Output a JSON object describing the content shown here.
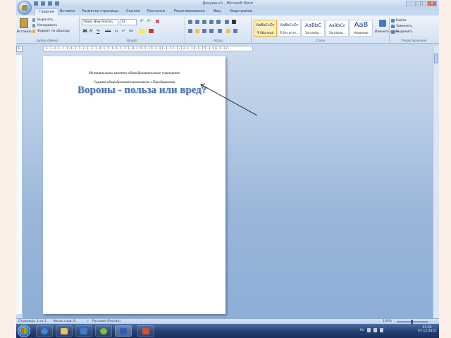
{
  "window": {
    "title": "Документ1 - Microsoft Word"
  },
  "window_controls": {
    "minimize": "–",
    "maximize": "□",
    "close": "x"
  },
  "tabs": [
    {
      "label": "Главная",
      "active": true
    },
    {
      "label": "Вставка"
    },
    {
      "label": "Разметка страницы"
    },
    {
      "label": "Ссылки"
    },
    {
      "label": "Рассылки"
    },
    {
      "label": "Рецензирование"
    },
    {
      "label": "Вид"
    },
    {
      "label": "Надстройки"
    }
  ],
  "clipboard": {
    "paste_label": "Вставить",
    "cut_label": "Вырезать",
    "copy_label": "Копировать",
    "format_painter_label": "Формат по образцу",
    "group_label": "Буфер обмена"
  },
  "font": {
    "name": "Times New Roman",
    "size": "11",
    "grow": "A˄",
    "shrink": "A˅",
    "bold": "Ж",
    "italic": "К",
    "underline": "Ч",
    "strike": "abe",
    "subscript": "x₂",
    "superscript": "x²",
    "case": "Aa",
    "group_label": "Шрифт"
  },
  "paragraph": {
    "group_label": "Абзац"
  },
  "styles": {
    "items": [
      {
        "preview": "AaBbCcDc",
        "name": "¶ Обычный",
        "selected": true
      },
      {
        "preview": "AaBbCcDc",
        "name": "¶ Без инте..."
      },
      {
        "preview": "AaBbC",
        "name": "Заголово..."
      },
      {
        "preview": "AaBbCc",
        "name": "Заголово..."
      },
      {
        "preview": "АаВ",
        "name": "Название"
      }
    ],
    "change_label": "Изменить стили",
    "group_label": "Стили"
  },
  "editing": {
    "find_label": "Найти",
    "replace_label": "Заменить",
    "select_label": "Выделить",
    "group_label": "Редактирование"
  },
  "ruler": {
    "corner": "L",
    "ticks": "3·1·2·1·1·1·X·1·1·2·1·3·1·4·1·5·1·6·1·7·1·8·1·9·1·10·1·11·1·12·1·13·1·14·1·15·1·16·1·17·"
  },
  "document": {
    "line1": "Муниципальное казенное общеобразовательное учреждение",
    "line2": "Средняя общеобразовательная школа с.Преображенка",
    "heading": "Вороны - польза или вред?"
  },
  "status": {
    "page": "Страница: 1 из 1",
    "words": "Число слов: 8",
    "language": "Русский (Россия)",
    "zoom": "100%"
  },
  "tray": {
    "time": "21:35",
    "date": "07.12.2015",
    "lang": "RU"
  },
  "colors": {
    "ribbon": "#dce8f6",
    "heading_text": "#4e74b8",
    "workspace": "#9ab6da",
    "taskbar": "#233e6e"
  }
}
